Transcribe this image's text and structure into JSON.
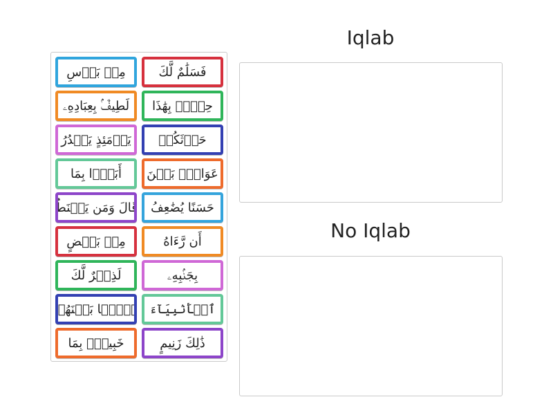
{
  "groups": [
    {
      "title": "Iqlab"
    },
    {
      "title": "No Iqlab"
    }
  ],
  "cards": [
    {
      "text": "فَسَلَٰمٌ لَّكَ",
      "color": "#d6313e"
    },
    {
      "text": "مِنۢ بَأۡسِ",
      "color": "#30a5dd"
    },
    {
      "text": "حِلٌّۢ بِهَٰذَا",
      "color": "#2fb55a"
    },
    {
      "text": "لَطِيفٌۢ بِعِبَادِهِۦ",
      "color": "#f08a24"
    },
    {
      "text": "حَرۡثَكُمۡ",
      "color": "#3340b2"
    },
    {
      "text": "يَوۡمَئِذٍ يَصۡدُرُ",
      "color": "#cf68d6"
    },
    {
      "text": "عَوَانٌۢ بَيۡنَ",
      "color": "#ee6b2c"
    },
    {
      "text": "أَبَدًۢا بِمَا",
      "color": "#63c898"
    },
    {
      "text": "حَسَنًا يُضَٰعِفُ",
      "color": "#35a4dc"
    },
    {
      "text": "قَالَ وَمَن يَقۡنَطُ",
      "color": "#8d45c9"
    },
    {
      "text": "أَن رَّءَاهُ",
      "color": "#f08a24"
    },
    {
      "text": "مِنۢ بَعۡضٍ",
      "color": "#d6313e"
    },
    {
      "text": "بِجَنۢبِهِۦ",
      "color": "#cf68d6"
    },
    {
      "text": "لَذِكۡرٌ لَّكَ",
      "color": "#2fb55a"
    },
    {
      "text": "ٱلۡأَنۢبِيَآءَ",
      "color": "#63c898"
    },
    {
      "text": "بَغۡيًۢا بَيۡنَهُمۡ",
      "color": "#3340b2"
    },
    {
      "text": "ذَٰلِكَ زَنِيمٍ",
      "color": "#8d45c9"
    },
    {
      "text": "خَبِيرٌۢ بِمَا",
      "color": "#ee6b2c"
    }
  ]
}
